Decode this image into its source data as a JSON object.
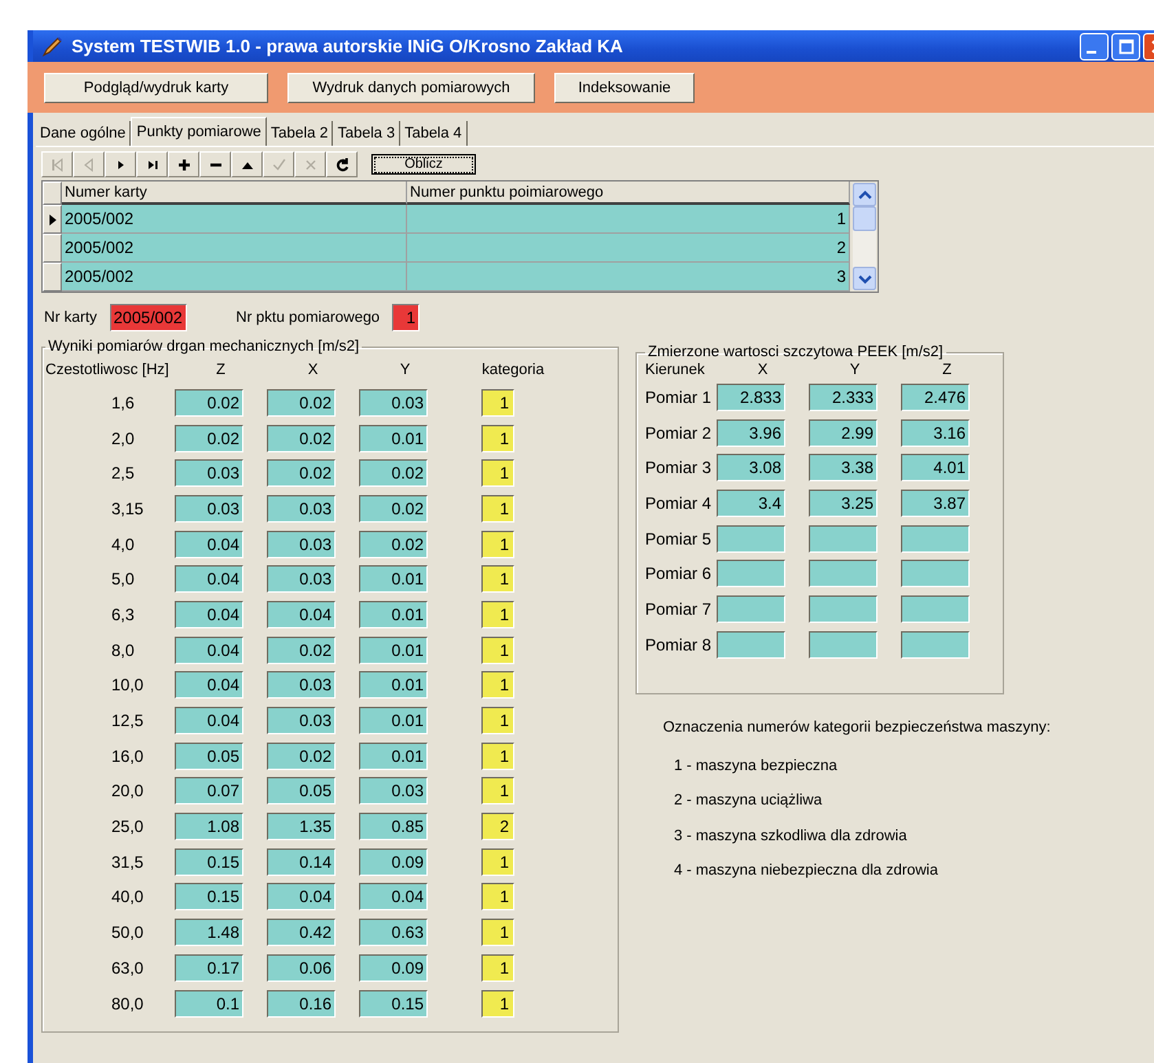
{
  "window": {
    "title": "System TESTWIB 1.0 - prawa autorskie INiG O/Krosno Zakład KA"
  },
  "toolbar_buttons": [
    "Podgląd/wydruk karty",
    "Wydruk danych pomiarowych",
    "Indeksowanie"
  ],
  "tabs": [
    {
      "label": "Dane ogólne",
      "selected": false
    },
    {
      "label": "Punkty pomiarowe",
      "selected": true
    },
    {
      "label": "Tabela 2",
      "selected": false
    },
    {
      "label": "Tabela 3",
      "selected": false
    },
    {
      "label": "Tabela 4",
      "selected": false
    }
  ],
  "navigator": [
    {
      "kind": "first",
      "disabled": true
    },
    {
      "kind": "prior",
      "disabled": true
    },
    {
      "kind": "next",
      "disabled": false
    },
    {
      "kind": "last",
      "disabled": false
    },
    {
      "kind": "insert",
      "disabled": false
    },
    {
      "kind": "delete",
      "disabled": false
    },
    {
      "kind": "edit",
      "disabled": false
    },
    {
      "kind": "post",
      "disabled": true
    },
    {
      "kind": "cancel",
      "disabled": true
    },
    {
      "kind": "refresh",
      "disabled": false
    }
  ],
  "calc_button": "Oblicz",
  "grid": {
    "columns": [
      "Numer karty",
      "Numer punktu poimiarowego"
    ],
    "rows": [
      {
        "numer_karty": "2005/002",
        "numer_punktu": "1",
        "selected": true
      },
      {
        "numer_karty": "2005/002",
        "numer_punktu": "2",
        "selected": false
      },
      {
        "numer_karty": "2005/002",
        "numer_punktu": "3",
        "selected": false
      }
    ]
  },
  "nr_karty": {
    "label": "Nr karty",
    "value": "2005/002"
  },
  "nr_pktu": {
    "label": "Nr pktu pomiarowego",
    "value": "1"
  },
  "vibration": {
    "title": "Wyniki pomiarów drgan mechanicznych [m/s2]",
    "columns": [
      "Czestotliwosc [Hz]",
      "Z",
      "X",
      "Y",
      "kategoria"
    ],
    "rows": [
      {
        "freq": "1,6",
        "values": [
          "0.02",
          "0.02",
          "0.03"
        ],
        "kategoria": "1"
      },
      {
        "freq": "2,0",
        "values": [
          "0.02",
          "0.02",
          "0.01"
        ],
        "kategoria": "1"
      },
      {
        "freq": "2,5",
        "values": [
          "0.03",
          "0.02",
          "0.02"
        ],
        "kategoria": "1"
      },
      {
        "freq": "3,15",
        "values": [
          "0.03",
          "0.03",
          "0.02"
        ],
        "kategoria": "1"
      },
      {
        "freq": "4,0",
        "values": [
          "0.04",
          "0.03",
          "0.02"
        ],
        "kategoria": "1"
      },
      {
        "freq": "5,0",
        "values": [
          "0.04",
          "0.03",
          "0.01"
        ],
        "kategoria": "1"
      },
      {
        "freq": "6,3",
        "values": [
          "0.04",
          "0.04",
          "0.01"
        ],
        "kategoria": "1"
      },
      {
        "freq": "8,0",
        "values": [
          "0.04",
          "0.02",
          "0.01"
        ],
        "kategoria": "1"
      },
      {
        "freq": "10,0",
        "values": [
          "0.04",
          "0.03",
          "0.01"
        ],
        "kategoria": "1"
      },
      {
        "freq": "12,5",
        "values": [
          "0.04",
          "0.03",
          "0.01"
        ],
        "kategoria": "1"
      },
      {
        "freq": "16,0",
        "values": [
          "0.05",
          "0.02",
          "0.01"
        ],
        "kategoria": "1"
      },
      {
        "freq": "20,0",
        "values": [
          "0.07",
          "0.05",
          "0.03"
        ],
        "kategoria": "1"
      },
      {
        "freq": "25,0",
        "values": [
          "1.08",
          "1.35",
          "0.85"
        ],
        "kategoria": "2"
      },
      {
        "freq": "31,5",
        "values": [
          "0.15",
          "0.14",
          "0.09"
        ],
        "kategoria": "1"
      },
      {
        "freq": "40,0",
        "values": [
          "0.15",
          "0.04",
          "0.04"
        ],
        "kategoria": "1"
      },
      {
        "freq": "50,0",
        "values": [
          "1.48",
          "0.42",
          "0.63"
        ],
        "kategoria": "1"
      },
      {
        "freq": "63,0",
        "values": [
          "0.17",
          "0.06",
          "0.09"
        ],
        "kategoria": "1"
      },
      {
        "freq": "80,0",
        "values": [
          "0.1",
          "0.16",
          "0.15"
        ],
        "kategoria": "1"
      }
    ]
  },
  "peek": {
    "title": "Zmierzone wartosci szczytowa PEEK [m/s2]",
    "row_header": "Kierunek",
    "columns": [
      "X",
      "Y",
      "Z"
    ],
    "rows": [
      {
        "label": "Pomiar 1",
        "values": [
          "2.833",
          "2.333",
          "2.476"
        ]
      },
      {
        "label": "Pomiar 2",
        "values": [
          "3.96",
          "2.99",
          "3.16"
        ]
      },
      {
        "label": "Pomiar 3",
        "values": [
          "3.08",
          "3.38",
          "4.01"
        ]
      },
      {
        "label": "Pomiar 4",
        "values": [
          "3.4",
          "3.25",
          "3.87"
        ]
      },
      {
        "label": "Pomiar 5"
      },
      {
        "label": "Pomiar 6"
      },
      {
        "label": "Pomiar 7"
      },
      {
        "label": "Pomiar 8"
      }
    ]
  },
  "legend": {
    "title": "Oznaczenia numerów kategorii bezpieczeństwa maszyny:",
    "items": [
      "1 - maszyna bezpieczna",
      "2 - maszyna uciążliwa",
      "3 - maszyna szkodliwa dla zdrowia",
      "4 - maszyna niebezpieczna dla zdrowia"
    ]
  }
}
